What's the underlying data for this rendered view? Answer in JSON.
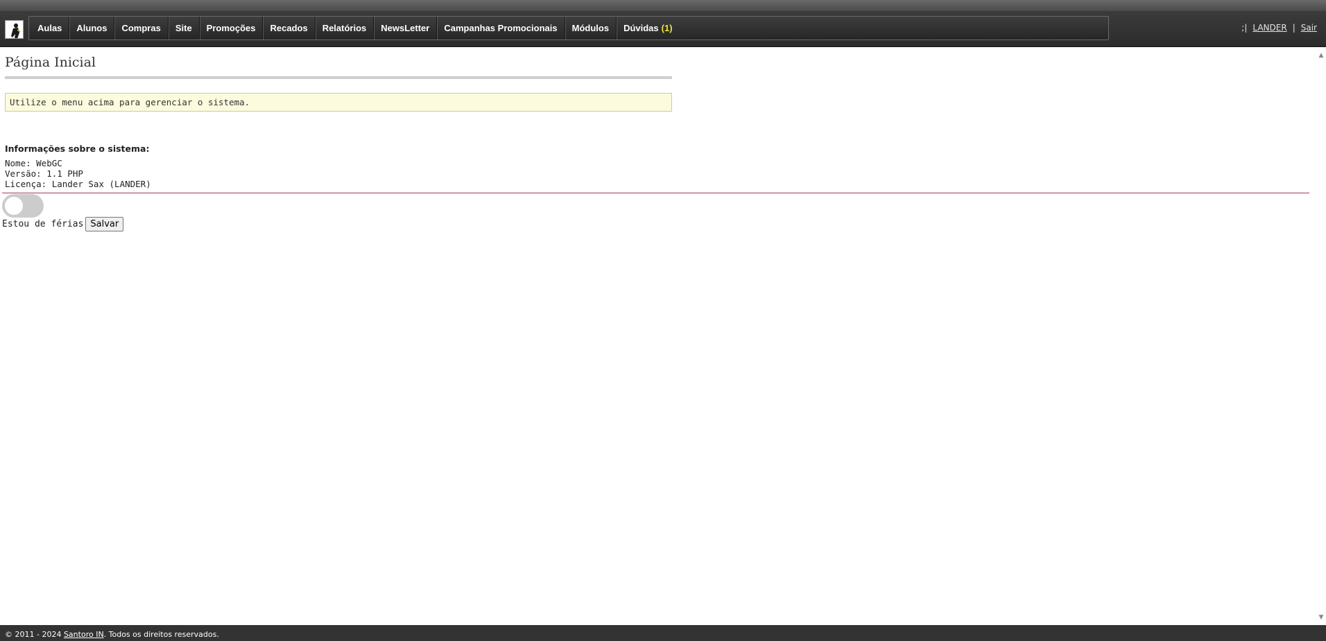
{
  "header": {
    "menu": [
      {
        "label": "Aulas"
      },
      {
        "label": "Alunos"
      },
      {
        "label": "Compras"
      },
      {
        "label": "Site"
      },
      {
        "label": "Promoções"
      },
      {
        "label": "Recados"
      },
      {
        "label": "Relatórios"
      },
      {
        "label": "NewsLetter"
      },
      {
        "label": "Campanhas Promocionais"
      },
      {
        "label": "Módulos"
      },
      {
        "label": "Dúvidas",
        "badge": "(1)"
      }
    ],
    "user": {
      "prefix": ";|",
      "name": "LANDER",
      "separator": "|",
      "logout": "Sair"
    }
  },
  "main": {
    "title": "Página Inicial",
    "notice": "Utilize o menu acima para gerenciar o sistema.",
    "info_heading": "Informações sobre o sistema:",
    "info": {
      "name": "Nome: WebGC",
      "version": "Versão: 1.1 PHP",
      "license": "Licença: Lander Sax (LANDER)"
    },
    "vacation": {
      "label": "Estou de férias",
      "save_label": "Salvar",
      "toggle_on": false
    }
  },
  "footer": {
    "copyright": "© 2011 - 2024",
    "company": "Santoro IN",
    "rights": ". Todos os direitos reservados."
  },
  "icons": {
    "logo": "person-logo-icon",
    "scroll_up": "scroll-up-arrow-icon",
    "scroll_down": "scroll-down-arrow-icon"
  },
  "colors": {
    "header_bg": "#2c2c2c",
    "badge": "#f2e23a",
    "notice_bg": "#fdfbde",
    "divider": "#a93a52",
    "footer_bg": "#333333"
  }
}
